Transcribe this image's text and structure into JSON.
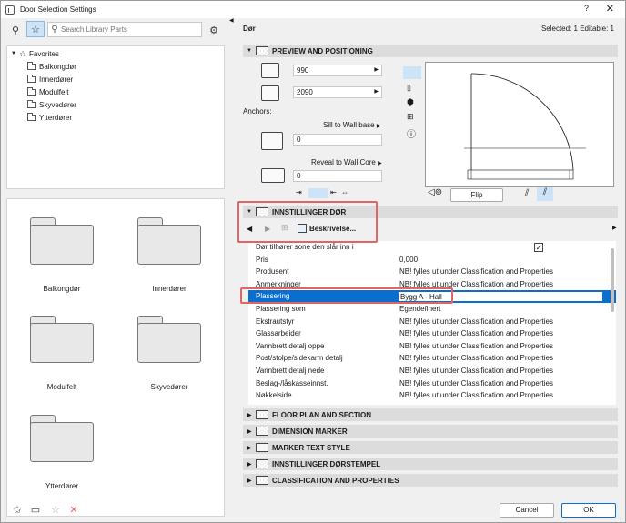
{
  "window": {
    "title": "Door Selection Settings",
    "help": "?",
    "close": "✕"
  },
  "left": {
    "search_placeholder": "Search Library Parts",
    "tree": {
      "root": "Favorites",
      "children": [
        "Balkongdør",
        "Innerdører",
        "Modulfelt",
        "Skyvedører",
        "Ytterdører"
      ]
    },
    "grid_items": [
      "Balkongdør",
      "Innerdører",
      "Modulfelt",
      "Skyvedører",
      "Ytterdører"
    ]
  },
  "header": {
    "name": "Dør",
    "status": "Selected: 1 Editable: 1"
  },
  "sections": {
    "preview": "PREVIEW AND POSITIONING",
    "settings": "INNSTILLINGER DØR",
    "floor_plan": "FLOOR PLAN AND SECTION",
    "dimension": "DIMENSION MARKER",
    "marker": "MARKER TEXT STYLE",
    "stamp": "INNSTILLINGER DØRSTEMPEL",
    "classification": "CLASSIFICATION AND PROPERTIES"
  },
  "preview": {
    "width": "990",
    "height": "2090",
    "anchors_label": "Anchors:",
    "sill_label": "Sill to Wall base",
    "sill_value": "0",
    "reveal_label": "Reveal to Wall Core",
    "reveal_value": "0",
    "flip_label": "Flip"
  },
  "settings": {
    "page_button": "Beskrivelse...",
    "rows": [
      {
        "name": "Dør tilhører sone den slår inn i",
        "value": "✓"
      },
      {
        "name": "Pris",
        "value": "0,000"
      },
      {
        "name": "Produsent",
        "value": "NB! fylles ut under Classification and Properties"
      },
      {
        "name": "Anmerkninger",
        "value": "NB! fylles ut under Classification and Properties"
      },
      {
        "name": "Plassering",
        "value": "Bygg A - Hall"
      },
      {
        "name": "Plassering som",
        "value": "Egendefinert"
      },
      {
        "name": "Ekstrautstyr",
        "value": "NB! fylles ut under Classification and Properties"
      },
      {
        "name": "Glassarbeider",
        "value": "NB! fylles ut under Classification and Properties"
      },
      {
        "name": "Vannbrett detalj oppe",
        "value": "NB! fylles ut under Classification and Properties"
      },
      {
        "name": "Post/stolpe/sidekarm detalj",
        "value": "NB! fylles ut under Classification and Properties"
      },
      {
        "name": "Vannbrett detalj nede",
        "value": "NB! fylles ut under Classification and Properties"
      },
      {
        "name": "Beslag-/låskasseinnst.",
        "value": "NB! fylles ut under Classification and Properties"
      },
      {
        "name": "Nøkkelside",
        "value": "NB! fylles ut under Classification and Properties"
      }
    ]
  },
  "footer": {
    "cancel": "Cancel",
    "ok": "OK"
  },
  "colors": {
    "selection": "#0a6ecf",
    "highlight_box": "#e06666"
  }
}
